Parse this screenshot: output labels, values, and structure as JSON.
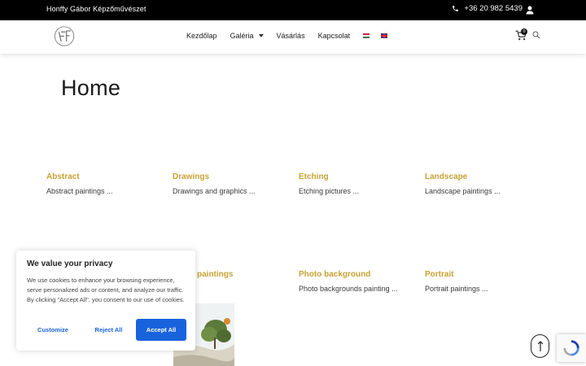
{
  "topbar": {
    "brand": "Honffy Gábor Képzőművészet",
    "phone": "+36 20 982 5439"
  },
  "nav": {
    "items": [
      {
        "label": "Kezdőlap"
      },
      {
        "label": "Galéria"
      },
      {
        "label": "Vásárlás"
      },
      {
        "label": "Kapcsolat"
      }
    ],
    "languages": [
      "hu",
      "en"
    ]
  },
  "cart": {
    "count": "0"
  },
  "page": {
    "title": "Home"
  },
  "categories": [
    {
      "title": "Abstract",
      "desc": "Abstract paintings ..."
    },
    {
      "title": "Drawings",
      "desc": "Drawings and graphics ..."
    },
    {
      "title": "Etching",
      "desc": "Etching pictures ..."
    },
    {
      "title": "Landscape",
      "desc": "Landscape paintings ..."
    },
    {
      "title": "paintings",
      "desc": ""
    },
    {
      "title": "Photo background",
      "desc": "Photo backgrounds painting ..."
    },
    {
      "title": "Portrait",
      "desc": "Portrait paintings ..."
    }
  ],
  "cookie": {
    "title": "We value your privacy",
    "text": "We use cookies to enhance your browsing experience, serve personalized ads or content, and analyze our traffic. By clicking \"Accept All\", you consent to our use of cookies.",
    "customize": "Customize",
    "reject": "Reject All",
    "accept": "Accept All"
  },
  "colors": {
    "accent": "#c9a134",
    "cookie_button": "#1863dc",
    "topbar": "#000000"
  },
  "icons": [
    "phone-icon",
    "user-icon",
    "logo",
    "cart-icon",
    "search-icon",
    "arrow-up-icon",
    "recaptcha-icon"
  ]
}
